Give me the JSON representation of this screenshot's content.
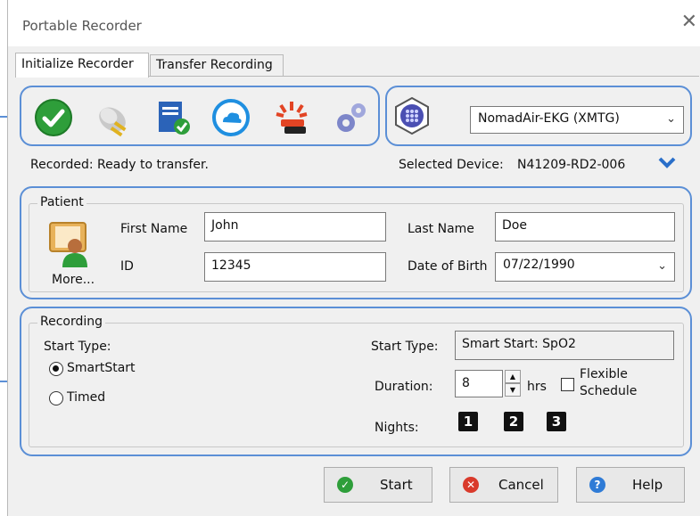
{
  "window": {
    "title": "Portable Recorder",
    "close_glyph": "✕"
  },
  "tabs": [
    {
      "label": "Initialize Recorder",
      "active": true
    },
    {
      "label": "Transfer Recording",
      "active": false
    }
  ],
  "toolbar": {
    "icons": [
      "check-circle-icon",
      "plug-icon",
      "save-document-icon",
      "cloud-icon",
      "alarm-light-icon",
      "gears-icon"
    ]
  },
  "device": {
    "icon": "recorder-device-icon",
    "selected_model": "NomadAir-EKG (XMTG)",
    "status": "Recorded: Ready to transfer.",
    "selected_label": "Selected Device:",
    "selected_id": "N41209-RD2-006"
  },
  "patient": {
    "group_title": "Patient",
    "more_label": "More...",
    "first_name_label": "First Name",
    "first_name": "John",
    "last_name_label": "Last Name",
    "last_name": "Doe",
    "id_label": "ID",
    "id": "12345",
    "dob_label": "Date of Birth",
    "dob": "07/22/1990"
  },
  "recording": {
    "group_title": "Recording",
    "start_type_label": "Start Type:",
    "options": [
      "SmartStart",
      "Timed"
    ],
    "selected_option": "SmartStart",
    "start_type_value_label": "Start Type:",
    "start_type_value": "Smart Start: SpO2",
    "duration_label": "Duration:",
    "duration": "8",
    "duration_unit": "hrs",
    "flexible_line1": "Flexible",
    "flexible_line2": "Schedule",
    "nights_label": "Nights:",
    "nights": [
      "1",
      "2",
      "3"
    ]
  },
  "buttons": {
    "start": "Start",
    "cancel": "Cancel",
    "help": "Help"
  },
  "colors": {
    "callout": "#5b8fd6",
    "start_icon": "#2e9e3a",
    "cancel_icon": "#d93a2b",
    "help_icon": "#2f7bd6",
    "chevron_blue": "#2a6fc9"
  }
}
